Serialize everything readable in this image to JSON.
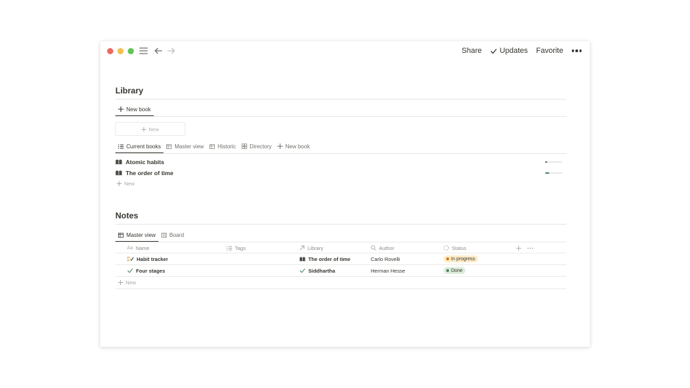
{
  "topbar": {
    "share_label": "Share",
    "updates_label": "Updates",
    "favorite_label": "Favorite"
  },
  "library": {
    "title": "Library",
    "top_tab_label": "New book",
    "new_card_label": "New",
    "view_tabs": [
      {
        "label": "Current books",
        "icon": "list-icon"
      },
      {
        "label": "Master view",
        "icon": "table-icon"
      },
      {
        "label": "Historic",
        "icon": "table-icon"
      },
      {
        "label": "Directory",
        "icon": "gallery-icon"
      },
      {
        "label": "New book",
        "icon": "plus-icon"
      }
    ],
    "items": [
      {
        "title": "Atomic habits",
        "icon": "book-icon",
        "progress": 0.1
      },
      {
        "title": "The order of time",
        "icon": "book-icon",
        "progress": 0.25
      }
    ],
    "new_label": "New"
  },
  "notes": {
    "title": "Notes",
    "view_tabs": [
      {
        "label": "Master view",
        "icon": "table-icon"
      },
      {
        "label": "Board",
        "icon": "board-icon"
      }
    ],
    "columns": [
      {
        "label": "Name",
        "icon": "text-prop-icon"
      },
      {
        "label": "Tags",
        "icon": "list-icon"
      },
      {
        "label": "Library",
        "icon": "relation-arrow-icon"
      },
      {
        "label": "Author",
        "icon": "search-icon"
      },
      {
        "label": "Status",
        "icon": "status-icon"
      }
    ],
    "rows": [
      {
        "name": "Habit tracker",
        "name_icon": "checklist-icon",
        "library": "The order of time",
        "library_icon": "book-icon",
        "author": "Carlo Rovelli",
        "status": "In progress",
        "status_bg": "#fdecc8",
        "status_dot": "#d9730d"
      },
      {
        "name": "Four stages",
        "name_icon": "checkmark-icon",
        "library": "Siddhartha",
        "library_icon": "checkmark-icon",
        "author": "Herman Hesse",
        "status": "Done",
        "status_bg": "#dbeddb",
        "status_dot": "#448361"
      }
    ],
    "new_label": "New"
  },
  "colors": {
    "text": "#37352f",
    "muted": "#8d8c88",
    "divider": "#e6e5e2",
    "checkmark": "#448361",
    "checklist_accent": "#d9a13a"
  }
}
